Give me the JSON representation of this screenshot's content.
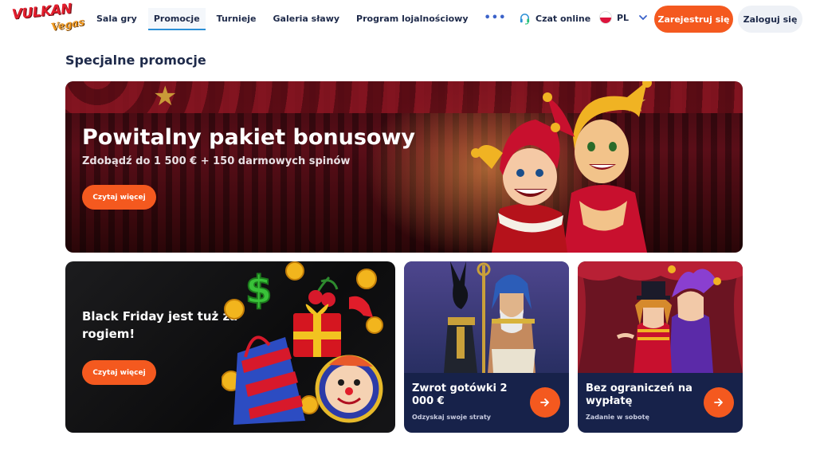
{
  "brand": {
    "logo_main": "VULKAN",
    "logo_sub": "Vegas"
  },
  "nav": {
    "items": [
      {
        "label": "Sala gry",
        "active": false
      },
      {
        "label": "Promocje",
        "active": true
      },
      {
        "label": "Turnieje",
        "active": false
      },
      {
        "label": "Galeria sławy",
        "active": false
      },
      {
        "label": "Program lojalnościowy",
        "active": false
      }
    ],
    "more_icon": "more-dots-icon"
  },
  "header": {
    "chat_label": "Czat online",
    "chat_icon": "headset-icon",
    "language": "PL",
    "language_flag": "poland-flag-icon",
    "register_label": "Zarejestruj się",
    "login_label": "Zaloguj się"
  },
  "page": {
    "title": "Specjalne promocje"
  },
  "promos": {
    "welcome": {
      "title": "Powitalny pakiet bonusowy",
      "subtitle": "Zdobądź do 1 500 € + 150 darmowych spinów",
      "button": "Czytaj więcej"
    },
    "black_friday": {
      "title": "Black Friday jest tuż za rogiem!",
      "button": "Czytaj więcej"
    },
    "cashback": {
      "title": "Zwrot gotówki 2 000 €",
      "caption": "Odzyskaj swoje straty",
      "arrow_icon": "arrow-right-icon"
    },
    "no_limit": {
      "title": "Bez ograniczeń na wypłatę",
      "caption": "Zadanie w sobotę",
      "arrow_icon": "arrow-right-icon"
    }
  },
  "colors": {
    "accent": "#f4591f",
    "navy": "#1e2a4a",
    "card_navy": "#17224a",
    "active_underline": "#2b8fd6"
  }
}
